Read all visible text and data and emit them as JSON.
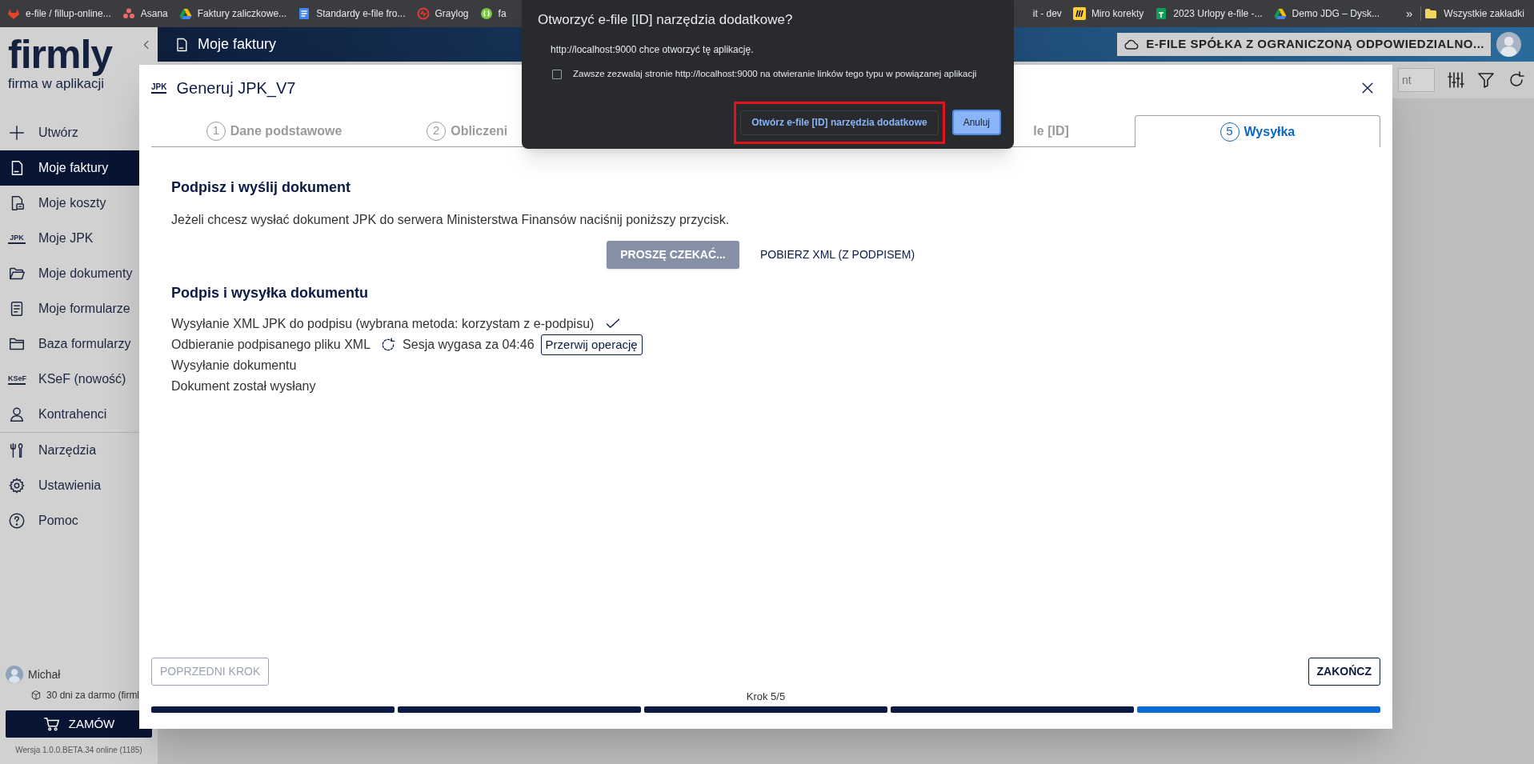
{
  "bookmarks": {
    "left": [
      {
        "label": "e-file / fillup-online..."
      },
      {
        "label": "Asana"
      },
      {
        "label": "Faktury zaliczkowe..."
      },
      {
        "label": "Standardy e-file fro..."
      },
      {
        "label": "Graylog"
      },
      {
        "label": "fa"
      }
    ],
    "right": [
      {
        "label": "it - dev"
      },
      {
        "label": "Miro korekty"
      },
      {
        "label": "2023 Urlopy e-file -..."
      },
      {
        "label": "Demo JDG – Dysk..."
      }
    ],
    "overflow": "»",
    "all_bookmarks": "Wszystkie zakładki"
  },
  "permission_dialog": {
    "title": "Otworzyć e-file [ID] narzędzia dodatkowe?",
    "message": "http://localhost:9000 chce otworzyć tę aplikację.",
    "checkbox": {
      "label": "Zawsze zezwalaj stronie http://localhost:9000 na otwieranie linków tego typu w powiązanej aplikacji",
      "checked": false
    },
    "buttons": [
      {
        "label": "Otwórz e-file [ID] narzędzia dodatkowe",
        "kind": "secondary",
        "highlighted": true
      },
      {
        "label": "Anuluj",
        "kind": "primary",
        "highlighted": false
      }
    ]
  },
  "sidebar": {
    "logo": "firmly",
    "tagline": "firma w aplikacji",
    "items": [
      {
        "label": "Utwórz",
        "selected": false
      },
      {
        "label": "Moje faktury",
        "selected": true
      },
      {
        "label": "Moje koszty",
        "selected": false
      },
      {
        "label": "Moje JPK",
        "selected": false,
        "icon_text": "JPK"
      },
      {
        "label": "Moje dokumenty",
        "selected": false
      },
      {
        "label": "Moje formularze",
        "selected": false
      },
      {
        "label": "Baza formularzy",
        "selected": false
      },
      {
        "label": "KSeF (nowość)",
        "selected": false,
        "icon_text": "KSeF"
      },
      {
        "label": "Kontrahenci",
        "selected": false
      },
      {
        "label": "Narzędzia",
        "selected": false
      },
      {
        "label": "Ustawienia",
        "selected": false
      },
      {
        "label": "Pomoc",
        "selected": false
      }
    ],
    "user": "Michał",
    "trial": "30 dni za darmo (firml",
    "order_button": "ZAMÓW",
    "version": "Wersja 1.0.0.BETA.34 online (1185)"
  },
  "header": {
    "title": "Moje faktury",
    "company": "E-FILE SPÓŁKA Z OGRANICZONĄ ODPOWIEDZIALNO...",
    "search_value": "nt"
  },
  "modal": {
    "icon_text": "JPK",
    "title": "Generuj JPK_V7",
    "tabs": [
      {
        "number": "1",
        "label": "Dane podstawowe",
        "selected": false
      },
      {
        "number": "2",
        "label": "Obliczeni",
        "selected": false
      },
      {
        "label": "le [ID]",
        "selected": false
      },
      {
        "number": "5",
        "label": "Wysyłka",
        "selected": true
      }
    ],
    "sign_section": {
      "heading": "Podpisz i wyślij dokument",
      "text": "Jeżeli chcesz wysłać dokument JPK do serwera Ministerstwa Finansów naciśnij poniższy przycisk.",
      "buttons": [
        {
          "label": "PROSZĘ CZEKAĆ...",
          "kind": "button",
          "disabled": true
        },
        {
          "label": "POBIERZ XML (Z PODPISEM)",
          "kind": "link",
          "disabled": false
        }
      ]
    },
    "progress_section": {
      "heading": "Podpis i wysyłka dokumentu",
      "steps": [
        {
          "label": "Wysyłanie XML JPK do podpisu (wybrana metoda: korzystam z e-podpisu)",
          "kind": "done"
        },
        {
          "label": "Odbieranie podpisanego pliku XML",
          "kind": "active",
          "note": "Sesja wygasa za 04:46",
          "action": "Przerwij operację"
        },
        {
          "label": "Wysyłanie dokumentu",
          "kind": "pending"
        },
        {
          "label": "Dokument został wysłany",
          "kind": "pending"
        }
      ]
    },
    "back_button": {
      "label": "POPRZEDNI KROK",
      "disabled": true
    },
    "finish_button": "ZAKOŃCZ",
    "step_label": "Krok 5/5",
    "progress": [
      {
        "selected": false
      },
      {
        "selected": false
      },
      {
        "selected": false
      },
      {
        "selected": false
      },
      {
        "selected": true
      }
    ]
  }
}
